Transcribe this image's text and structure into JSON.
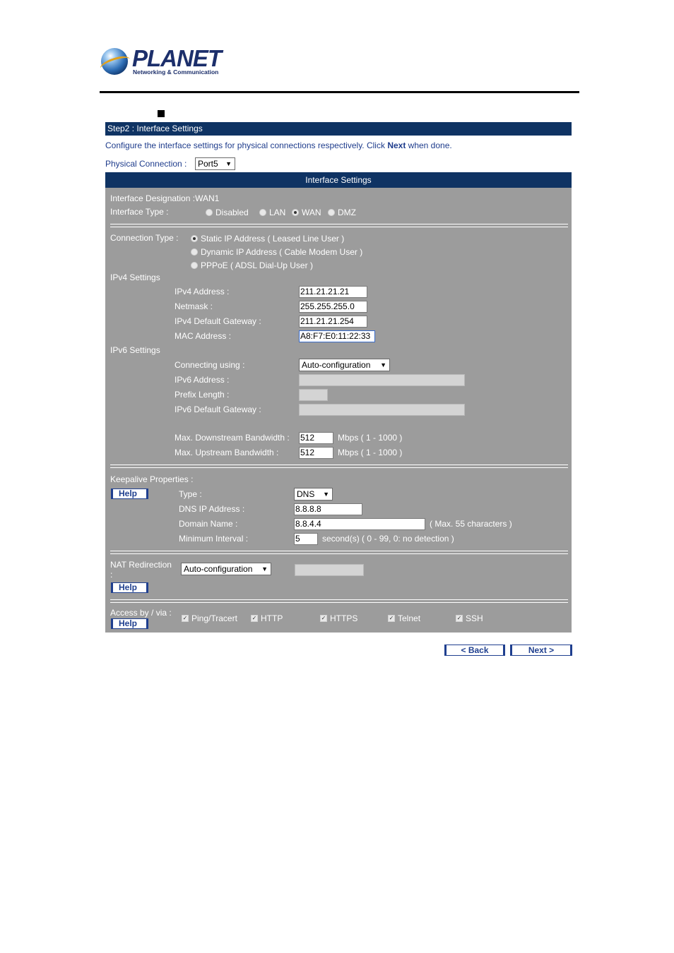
{
  "logo": {
    "name": "PLANET",
    "tagline": "Networking & Communication"
  },
  "step": {
    "title": "Step2 : Interface Settings"
  },
  "description": {
    "prefix": "Configure the interface settings for physical connections respectively. Click ",
    "bold": "Next",
    "suffix": " when done."
  },
  "physical_connection": {
    "label": "Physical Connection :",
    "value": "Port5"
  },
  "panel": {
    "title": "Interface Settings",
    "designation": "Interface Designation :WAN1",
    "interface_type": {
      "label": "Interface Type :",
      "options": [
        "Disabled",
        "LAN",
        "WAN",
        "DMZ"
      ],
      "selected": "WAN"
    },
    "connection_type": {
      "label": "Connection Type :",
      "options": [
        "Static IP Address ( Leased Line User )",
        "Dynamic IP Address ( Cable Modem User )",
        "PPPoE ( ADSL Dial-Up User )"
      ],
      "selected": "Static IP Address ( Leased Line User )"
    },
    "ipv4": {
      "header": "IPv4 Settings",
      "address_label": "IPv4 Address :",
      "address": "211.21.21.21",
      "netmask_label": "Netmask :",
      "netmask": "255.255.255.0",
      "gateway_label": "IPv4 Default Gateway :",
      "gateway": "211.21.21.254",
      "mac_label": "MAC Address :",
      "mac": "A8:F7:E0:11:22:33"
    },
    "ipv6": {
      "header": "IPv6 Settings",
      "connecting_label": "Connecting using :",
      "connecting": "Auto-configuration",
      "address_label": "IPv6 Address :",
      "address": "",
      "prefix_label": "Prefix Length :",
      "prefix": "",
      "gateway_label": "IPv6 Default Gateway :",
      "gateway": ""
    },
    "bandwidth": {
      "down_label": "Max. Downstream Bandwidth :",
      "down": "512",
      "down_unit": "Mbps ( 1 - 1000 )",
      "up_label": "Max. Upstream Bandwidth :",
      "up": "512",
      "up_unit": "Mbps ( 1 - 1000 )"
    },
    "keepalive": {
      "header": "Keepalive Properties :",
      "help": "Help",
      "type_label": "Type :",
      "type": "DNS",
      "dns_label": "DNS IP Address :",
      "dns": "8.8.8.8",
      "domain_label": "Domain Name :",
      "domain": "8.8.4.4",
      "domain_hint": "( Max. 55 characters )",
      "interval_label": "Minimum Interval :",
      "interval": "5",
      "interval_hint": "second(s)  ( 0 - 99, 0: no detection )"
    },
    "nat": {
      "label": "NAT Redirection",
      "colon": ":",
      "value": "Auto-configuration",
      "field": "",
      "help": "Help"
    },
    "access": {
      "label": "Access by / via :",
      "help": "Help",
      "options": [
        "Ping/Tracert",
        "HTTP",
        "HTTPS",
        "Telnet",
        "SSH"
      ]
    }
  },
  "buttons": {
    "back": "< Back",
    "next": "Next >"
  }
}
